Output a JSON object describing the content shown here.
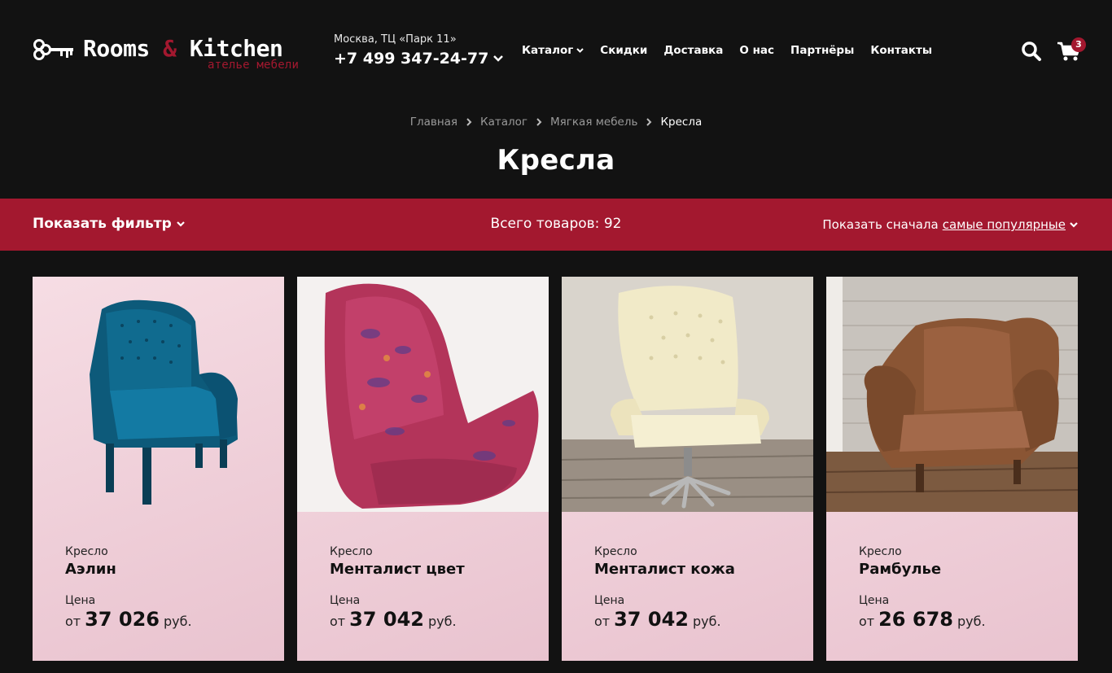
{
  "header": {
    "logo": {
      "word1": "Rooms",
      "amp": "&",
      "word2": "Kitchen",
      "subtitle": "ателье мебели"
    },
    "city": "Москва, ТЦ «Парк 11»",
    "phone": "+7 499 347-24-77",
    "nav": [
      "Каталог",
      "Скидки",
      "Доставка",
      "О нас",
      "Партнёры",
      "Контакты"
    ],
    "cart_count": "3",
    "icons": {
      "search": "search-icon",
      "cart": "cart-icon"
    }
  },
  "breadcrumb": [
    "Главная",
    "Каталог",
    "Мягкая мебель",
    "Кресла"
  ],
  "page_title": "Кресла",
  "filter_bar": {
    "filter_label": "Показать фильтр",
    "total_label": "Всего товаров: 92",
    "sort_prefix": "Показать сначала",
    "sort_value": "самые популярные"
  },
  "products": [
    {
      "type": "Кресло",
      "name": "Аэлин",
      "price_label": "Цена",
      "price_prefix": "от",
      "price": "37 026",
      "currency": "руб."
    },
    {
      "type": "Кресло",
      "name": "Менталист цвет",
      "price_label": "Цена",
      "price_prefix": "от",
      "price": "37 042",
      "currency": "руб."
    },
    {
      "type": "Кресло",
      "name": "Менталист кожа",
      "price_label": "Цена",
      "price_prefix": "от",
      "price": "37 042",
      "currency": "руб."
    },
    {
      "type": "Кресло",
      "name": "Рамбулье",
      "price_label": "Цена",
      "price_prefix": "от",
      "price": "26 678",
      "currency": "руб."
    }
  ],
  "colors": {
    "accent": "#a3182f",
    "background": "#121212",
    "card": "#efd0d9"
  }
}
